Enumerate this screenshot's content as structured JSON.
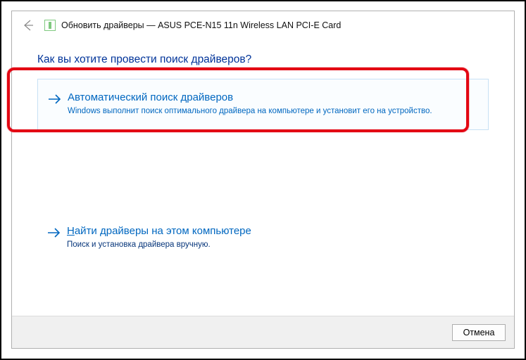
{
  "window": {
    "title": "Обновить драйверы — ASUS PCE-N15 11n Wireless LAN PCI-E Card"
  },
  "heading": "Как вы хотите провести поиск драйверов?",
  "options": {
    "auto": {
      "title": "Автоматический поиск драйверов",
      "desc": "Windows выполнит поиск оптимального драйвера на компьютере и установит его на устройство."
    },
    "browse": {
      "title": "Найти драйверы на этом компьютере",
      "desc": "Поиск и установка драйвера вручную."
    }
  },
  "buttons": {
    "cancel": "Отмена"
  }
}
